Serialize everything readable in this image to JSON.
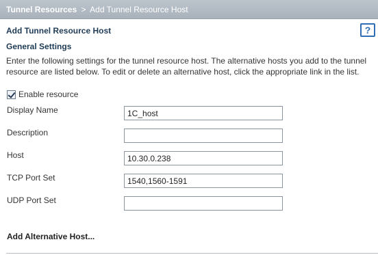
{
  "breadcrumb": {
    "parent": "Tunnel Resources",
    "separator": ">",
    "current": "Add Tunnel Resource Host"
  },
  "page": {
    "title": "Add Tunnel Resource Host",
    "help_label": "?"
  },
  "general": {
    "section_title": "General Settings",
    "intro": "Enter the following settings for the tunnel resource host. The alternative hosts you add to the tunnel resource are listed below. To edit or delete an alternative host, click the appropriate link in the list.",
    "enable_label": "Enable resource",
    "enable_checked": true
  },
  "fields": {
    "display_name": {
      "label": "Display Name",
      "value": "1C_host"
    },
    "description": {
      "label": "Description",
      "value": ""
    },
    "host": {
      "label": "Host",
      "value": "10.30.0.238"
    },
    "tcp_port_set": {
      "label": "TCP Port Set",
      "value": "1540,1560-1591"
    },
    "udp_port_set": {
      "label": "UDP Port Set",
      "value": ""
    }
  },
  "alternative": {
    "add_label": "Add Alternative Host..."
  },
  "colors": {
    "topbar": "#b3bbc4",
    "heading": "#1f3b55",
    "help_accent": "#2f6db4"
  }
}
